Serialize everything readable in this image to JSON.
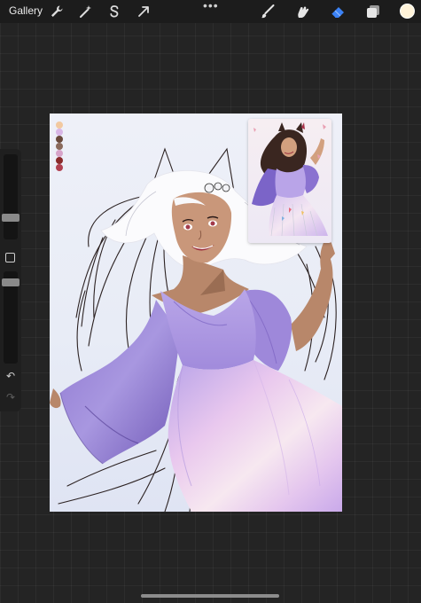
{
  "app": {
    "gallery_label": "Gallery"
  },
  "toolbar": {
    "left_tools": [
      "wrench-icon",
      "magic-wand-icon",
      "selection-s-icon",
      "transform-arrow-icon"
    ],
    "more_label": "•••",
    "right_tools": [
      "brush-icon",
      "smudge-icon",
      "eraser-icon",
      "layers-icon"
    ],
    "active_tool": "eraser-icon",
    "accent_color": "#3b82f6",
    "current_color": "#fff3d9"
  },
  "sidebar": {
    "brush_size_level": 0.52,
    "opacity_level": 0.45,
    "undo_icon": "undo-arrow-icon",
    "redo_icon": "redo-arrow-icon"
  },
  "canvas": {
    "palette_colors": [
      "#f2c9a0",
      "#d8b6e6",
      "#6a4a3c",
      "#8a6a5c",
      "#d7a3c9",
      "#8a2a2a",
      "#b04050"
    ],
    "reference_label": "reference-image"
  }
}
